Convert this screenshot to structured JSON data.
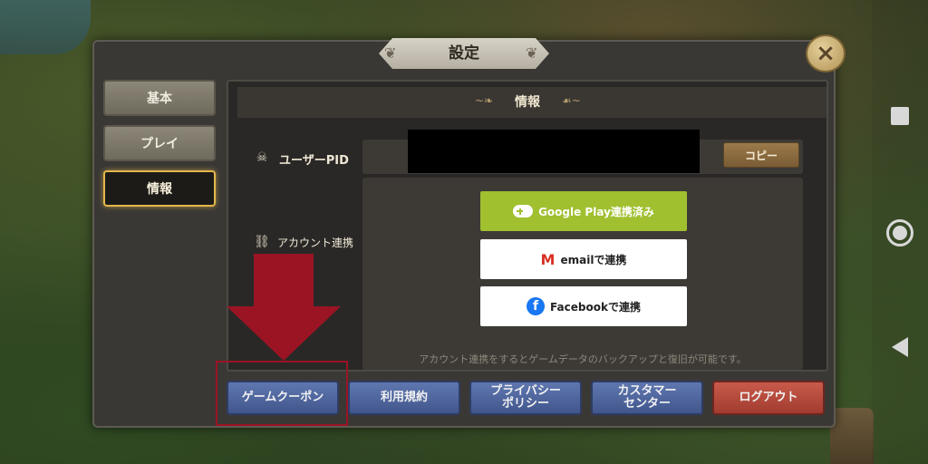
{
  "dialog": {
    "title": "設定",
    "close_label": "×"
  },
  "tabs": [
    {
      "label": "基本",
      "active": false
    },
    {
      "label": "プレイ",
      "active": false
    },
    {
      "label": "情報",
      "active": true
    }
  ],
  "panel": {
    "header": "情報",
    "user_pid_label": "ユーザーPID",
    "copy_button": "コピー",
    "account_link_label": "アカウント連携",
    "links": {
      "google": "Google Play連携済み",
      "email": "emailで連携",
      "facebook": "Facebookで連携"
    },
    "note": "アカウント連携をするとゲームデータのバックアップと復旧が可能です。"
  },
  "bottom_buttons": {
    "coupon": "ゲームクーポン",
    "terms": "利用規約",
    "privacy_line1": "プライバシー",
    "privacy_line2": "ポリシー",
    "support_line1": "カスタマー",
    "support_line2": "センター",
    "logout": "ログアウト"
  },
  "colors": {
    "accent_gold": "#e3b64a",
    "blue_button": "#5f77b0",
    "logout_red": "#c85a4a",
    "google_green": "#a0c030",
    "annotation_red": "#9a1424"
  },
  "icons": {
    "user_pid": "skull-icon",
    "account_link": "link-icon"
  }
}
